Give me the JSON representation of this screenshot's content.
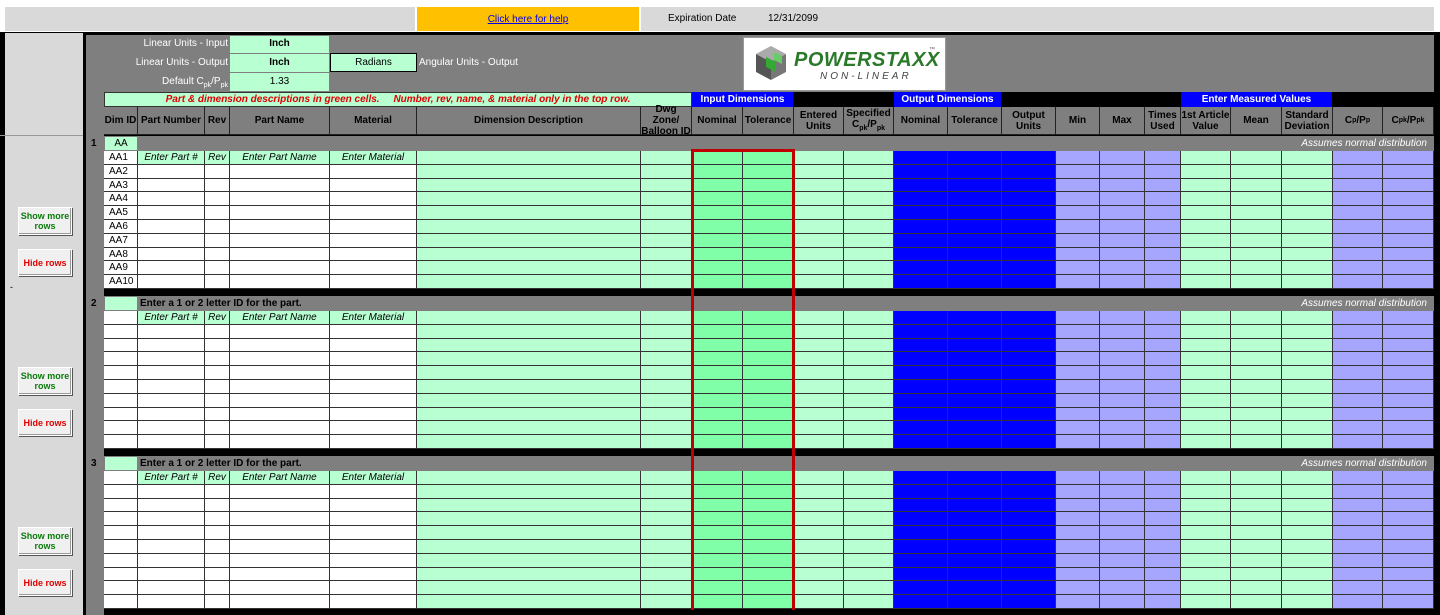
{
  "top": {
    "help_link": "Click here for help",
    "expiration_label": "Expiration Date",
    "expiration_value": "12/31/2099"
  },
  "settings": {
    "linear_input_label": "Linear Units - Input",
    "linear_input_value": "Inch",
    "linear_output_label": "Linear Units - Output",
    "linear_output_value": "Inch",
    "angular_value": "Radians",
    "angular_label": "Angular Units - Output",
    "cpk_label": "Default C",
    "cpk_value": "1.33"
  },
  "logo": {
    "main": "POWERSTAXX",
    "tm": "™",
    "sub": "NON-LINEAR"
  },
  "note": "Part & dimension descriptions in green cells.     Number, rev, name, & material only in the top row.",
  "section_headers": {
    "input_dims": "Input Dimensions",
    "output_dims": "Output Dimensions",
    "measured": "Enter Measured Values"
  },
  "columns": {
    "dim_id": "Dim ID",
    "part_number": "Part Number",
    "rev": "Rev",
    "part_name": "Part Name",
    "material": "Material",
    "dim_desc": "Dimension Description",
    "dwg_zone": "Dwg Zone/ Balloon ID",
    "nominal": "Nominal",
    "tolerance": "Tolerance",
    "entered_units": "Entered Units",
    "specified": "Specified",
    "out_nominal": "Nominal",
    "out_tolerance": "Tolerance",
    "output_units": "Output Units",
    "min": "Min",
    "max": "Max",
    "times_used": "Times Used",
    "first_article": "1st Article Value",
    "mean": "Mean",
    "std_dev": "Standard Deviation"
  },
  "parts": [
    {
      "number": "1",
      "part_id": "AA",
      "hint": "",
      "assumes": "Assumes normal distribution",
      "placeholders": {
        "part_number": "Enter Part #",
        "rev": "Rev",
        "part_name": "Enter Part Name",
        "material": "Enter Material"
      },
      "rows": [
        "AA1",
        "AA2",
        "AA3",
        "AA4",
        "AA5",
        "AA6",
        "AA7",
        "AA8",
        "AA9",
        "AA10"
      ]
    },
    {
      "number": "2",
      "part_id": "",
      "hint": "Enter a 1 or 2 letter ID for the part.",
      "assumes": "Assumes normal distribution",
      "placeholders": {
        "part_number": "Enter Part #",
        "rev": "Rev",
        "part_name": "Enter Part Name",
        "material": "Enter Material"
      },
      "rows": [
        "",
        "",
        "",
        "",
        "",
        "",
        "",
        "",
        "",
        ""
      ]
    },
    {
      "number": "3",
      "part_id": "",
      "hint": "Enter a 1 or 2 letter ID for the part.",
      "assumes": "Assumes normal distribution",
      "placeholders": {
        "part_number": "Enter Part #",
        "rev": "Rev",
        "part_name": "Enter Part Name",
        "material": "Enter Material"
      },
      "rows": [
        "",
        "",
        "",
        "",
        "",
        "",
        "",
        "",
        ""
      ]
    }
  ],
  "buttons": {
    "show_more_rows": "Show more rows",
    "hide_rows": "Hide rows"
  },
  "colors": {
    "light_green": "#b8ffd2",
    "mint": "#80ffa8",
    "blue": "#0000ff",
    "lavender": "#a6a6ff",
    "help_orange": "#ffc000",
    "gray": "#7f7f7f",
    "red_border": "#c00000"
  }
}
